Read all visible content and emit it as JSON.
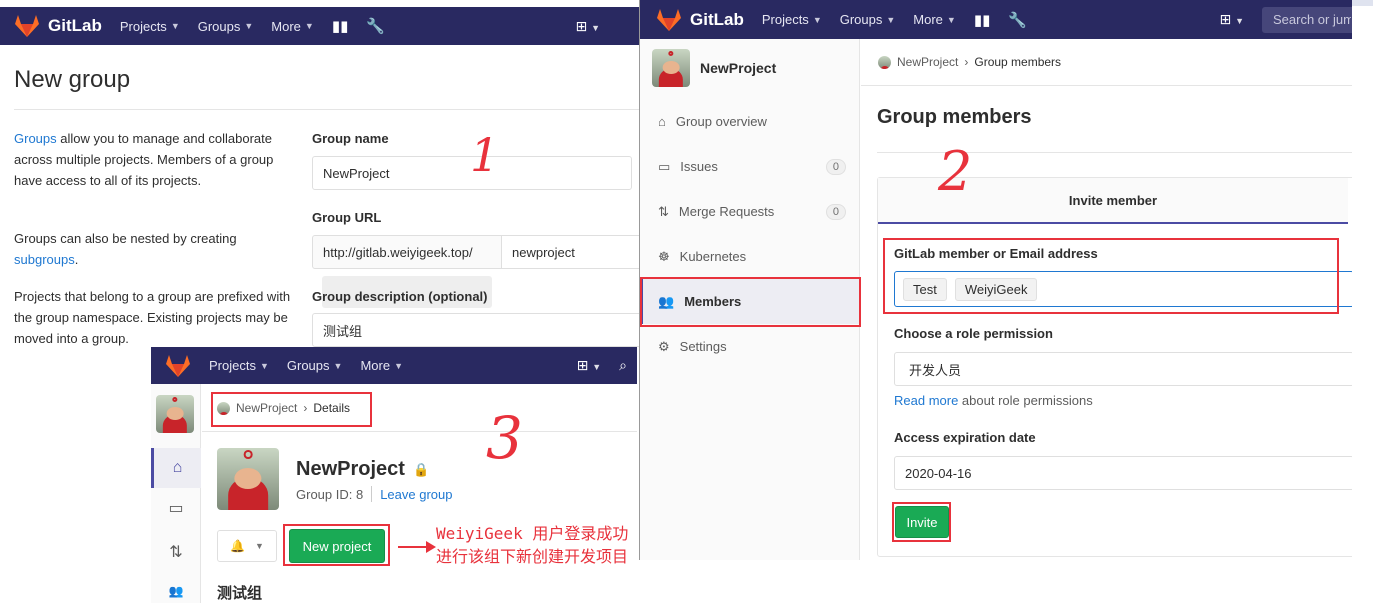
{
  "nav": {
    "brand": "GitLab",
    "projects": "Projects",
    "groups": "Groups",
    "more": "More",
    "search_placeholder": "Search or jump to..."
  },
  "new_group": {
    "title": "New group",
    "desc1_link": "Groups",
    "desc1_rest": " allow you to manage and collaborate across multiple projects. Members of a group have access to all of its projects.",
    "desc2_pre": "Groups can also be nested by creating ",
    "desc2_link": "subgroups",
    "desc2_post": ".",
    "desc3": "Projects that belong to a group are prefixed with the group namespace. Existing projects may be moved into a group.",
    "group_name_label": "Group name",
    "group_name_value": "NewProject",
    "group_url_label": "Group URL",
    "group_url_prefix": "http://gitlab.weiyigeek.top/",
    "group_url_value": "newproject",
    "group_desc_label": "Group description (optional)",
    "group_desc_value": "测试组"
  },
  "members_page": {
    "group_name": "NewProject",
    "sidebar": [
      {
        "label": "Group overview",
        "icon": "home-icon"
      },
      {
        "label": "Issues",
        "icon": "issues-icon",
        "count": "0"
      },
      {
        "label": "Merge Requests",
        "icon": "merge-request-icon",
        "count": "0"
      },
      {
        "label": "Kubernetes",
        "icon": "kubernetes-icon"
      },
      {
        "label": "Members",
        "icon": "members-icon"
      },
      {
        "label": "Settings",
        "icon": "settings-icon"
      }
    ],
    "breadcrumb_parent": "NewProject",
    "breadcrumb_current": "Group members",
    "title": "Group members",
    "tab_invite": "Invite member",
    "member_label": "GitLab member or Email address",
    "member_tokens": [
      "Test",
      "WeiyiGeek"
    ],
    "role_label": "Choose a role permission",
    "role_value": "开发人员",
    "read_more": "Read more",
    "read_more_rest": " about role permissions",
    "expiration_label": "Access expiration date",
    "expiration_value": "2020-04-16",
    "invite_button": "Invite"
  },
  "details_page": {
    "breadcrumb_parent": "NewProject",
    "breadcrumb_current": "Details",
    "group_title": "NewProject",
    "group_id": "Group ID: 8",
    "leave_group": "Leave group",
    "new_project_button": "New project",
    "description": "测试组"
  },
  "annotations": {
    "step1": "1",
    "step2": "2",
    "step3": "3",
    "note": "WeiyiGeek 用户登录成功进行该组下新创建开发项目"
  },
  "colors": {
    "navbar": "#292961",
    "accent_red": "#e8323c",
    "green": "#1aaa55",
    "link": "#1f78d1"
  }
}
